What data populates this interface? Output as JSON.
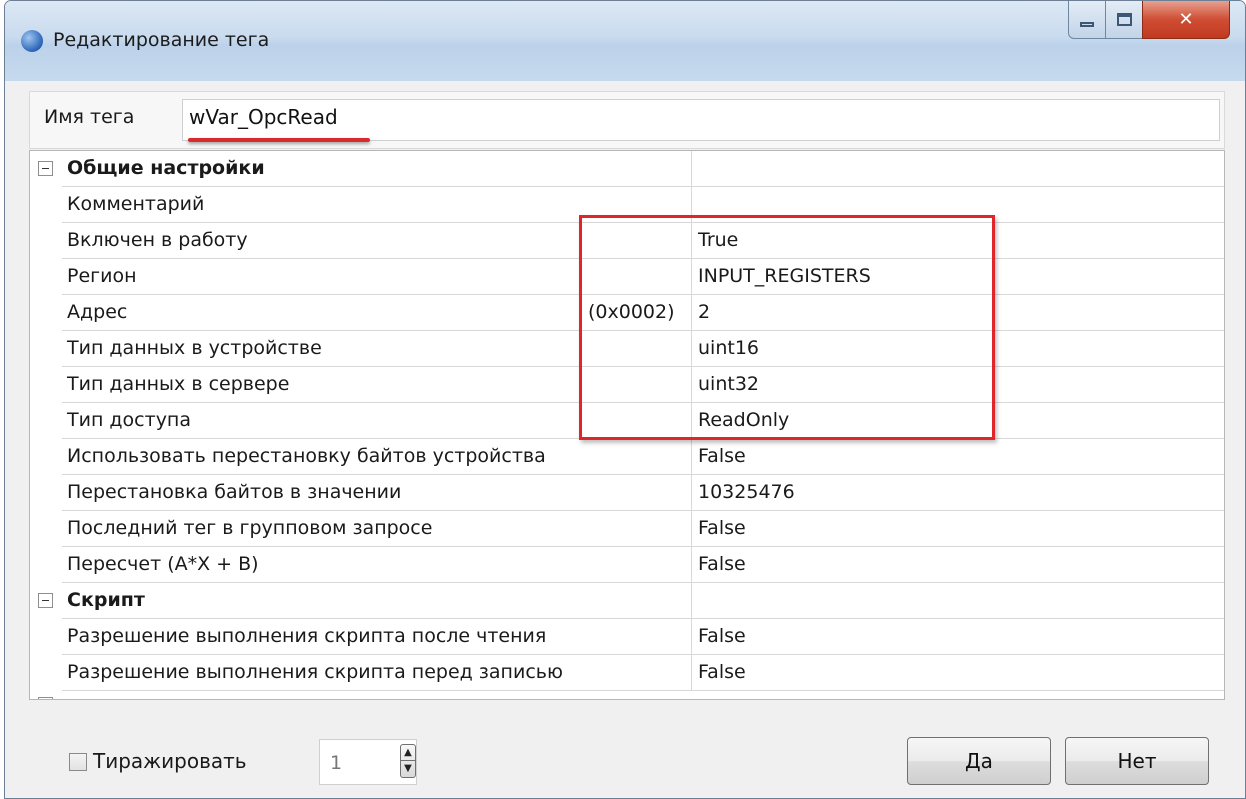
{
  "window": {
    "title": "Редактирование тега"
  },
  "tag": {
    "name_label": "Имя тега",
    "name_value": "wVar_OpcRead"
  },
  "grid": {
    "rows": [
      {
        "name": "Общие настройки",
        "value": "",
        "category": true
      },
      {
        "name": "Комментарий",
        "value": ""
      },
      {
        "name": "Включен в работу",
        "value": "True"
      },
      {
        "name": "Регион",
        "value": "INPUT_REGISTERS"
      },
      {
        "name": "Адрес",
        "value": "2",
        "note": "(0x0002)"
      },
      {
        "name": "Тип данных в устройстве",
        "value": "uint16"
      },
      {
        "name": "Тип данных в сервере",
        "value": "uint32"
      },
      {
        "name": "Тип доступа",
        "value": "ReadOnly"
      },
      {
        "name": "Использовать перестановку байтов устройства",
        "value": "False"
      },
      {
        "name": "Перестановка байтов в значении",
        "value": "10325476"
      },
      {
        "name": "Последний тег в групповом запросе",
        "value": "False"
      },
      {
        "name": "Пересчет (A*X + B)",
        "value": "False"
      },
      {
        "name": "Скрипт",
        "value": "",
        "category": true
      },
      {
        "name": "Разрешение выполнения скрипта после чтения",
        "value": "False"
      },
      {
        "name": "Разрешение выполнения скрипта перед записью",
        "value": "False"
      }
    ]
  },
  "footer": {
    "replicate_label": "Тиражировать",
    "replicate_count": "1",
    "yes_label": "Да",
    "no_label": "Нет"
  },
  "icons": {
    "app": "tag-app-icon",
    "minimize": "minimize-icon",
    "maximize": "maximize-icon",
    "close": "close-icon"
  },
  "colors": {
    "highlight": "#e0262a",
    "titlebar": "#c9dbee",
    "close_button": "#cf4d33"
  }
}
